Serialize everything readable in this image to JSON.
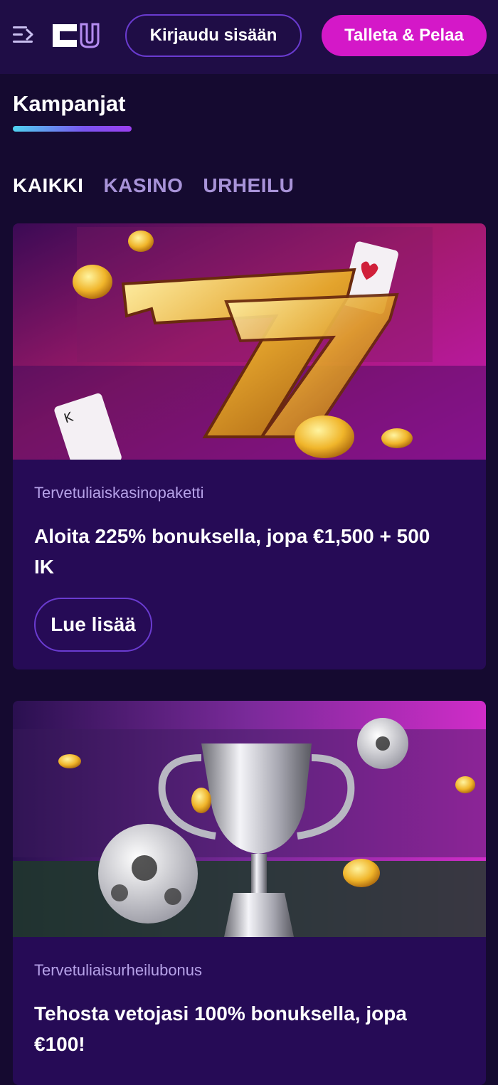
{
  "header": {
    "menu_icon": "menu-arrow-icon",
    "logo": "brand-logo",
    "login_label": "Kirjaudu sisään",
    "deposit_label": "Talleta & Pelaa",
    "colors": {
      "header_bg": "#1f0d46",
      "deposit_bg": "#d418c8",
      "login_border": "#6a3bd0"
    }
  },
  "page": {
    "title": "Kampanjat"
  },
  "tabs": [
    {
      "label": "KAIKKI",
      "active": true
    },
    {
      "label": "KASINO",
      "active": false
    },
    {
      "label": "URHEILU",
      "active": false
    }
  ],
  "promotions": [
    {
      "image": "slot-777-coins-cards",
      "category": "Tervetuliaiskasinopaketti",
      "title": "Aloita 225% bonuksella, jopa €1,500 + 500 IK",
      "button": "Lue lisää"
    },
    {
      "image": "trophy-footballs-stadium",
      "category": "Tervetuliaisurheilubonus",
      "title": "Tehosta vetojasi 100% bonuksella, jopa €100!"
    }
  ]
}
